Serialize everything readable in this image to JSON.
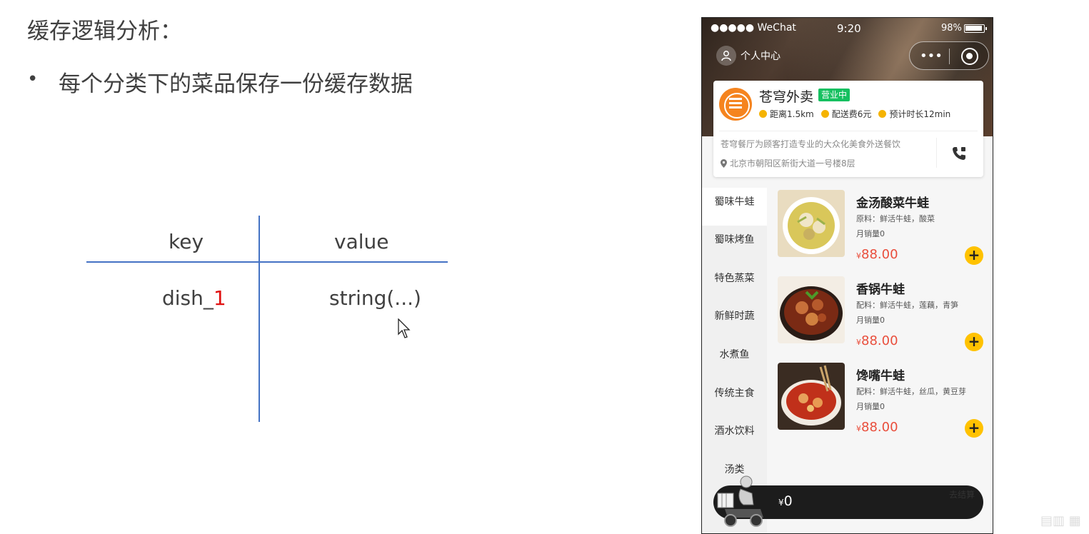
{
  "slide": {
    "title": "缓存逻辑分析：",
    "bullet": "每个分类下的菜品保存一份缓存数据",
    "table": {
      "key_header": "key",
      "value_header": "value",
      "key_prefix": "dish_",
      "key_suffix": "1",
      "value_cell": "string(...)"
    }
  },
  "phone": {
    "status_bar": {
      "carrier": "●●●●● WeChat",
      "time": "9:20",
      "battery": "98%"
    },
    "nav": {
      "profile_label": "个人中心",
      "more_label": "•••"
    },
    "shop": {
      "name": "苍穹外卖",
      "status": "营业中",
      "distance": "距离1.5km",
      "delivery_fee": "配送费6元",
      "eta": "预计时长12min",
      "description": "苍穹餐厅为顾客打造专业的大众化美食外送餐饮",
      "address": "北京市朝阳区新街大道一号楼8层"
    },
    "categories": [
      "蜀味牛蛙",
      "蜀味烤鱼",
      "特色蒸菜",
      "新鲜时蔬",
      "水煮鱼",
      "传统主食",
      "酒水饮料",
      "汤类"
    ],
    "dishes": [
      {
        "name": "金汤酸菜牛蛙",
        "desc": "原料：鲜活牛蛙，酸菜",
        "sales": "月销量0",
        "price_symbol": "¥",
        "price": "88.00",
        "add": "+"
      },
      {
        "name": "香锅牛蛙",
        "desc": "配料：鲜活牛蛙，莲藕，青笋",
        "sales": "月销量0",
        "price_symbol": "¥",
        "price": "88.00",
        "add": "+"
      },
      {
        "name": "馋嘴牛蛙",
        "desc": "配料：鲜活牛蛙，丝瓜，黄豆芽",
        "sales": "月销量0",
        "price_symbol": "¥",
        "price": "88.00",
        "add": "+"
      }
    ],
    "cart": {
      "total_symbol": "¥",
      "total": "0",
      "checkout": "去结算"
    }
  },
  "colors": {
    "accent_blue": "#4472c4",
    "highlight_red": "#e01010",
    "price_red": "#e94e3c",
    "add_yellow": "#ffc200",
    "status_green": "#16c060"
  }
}
